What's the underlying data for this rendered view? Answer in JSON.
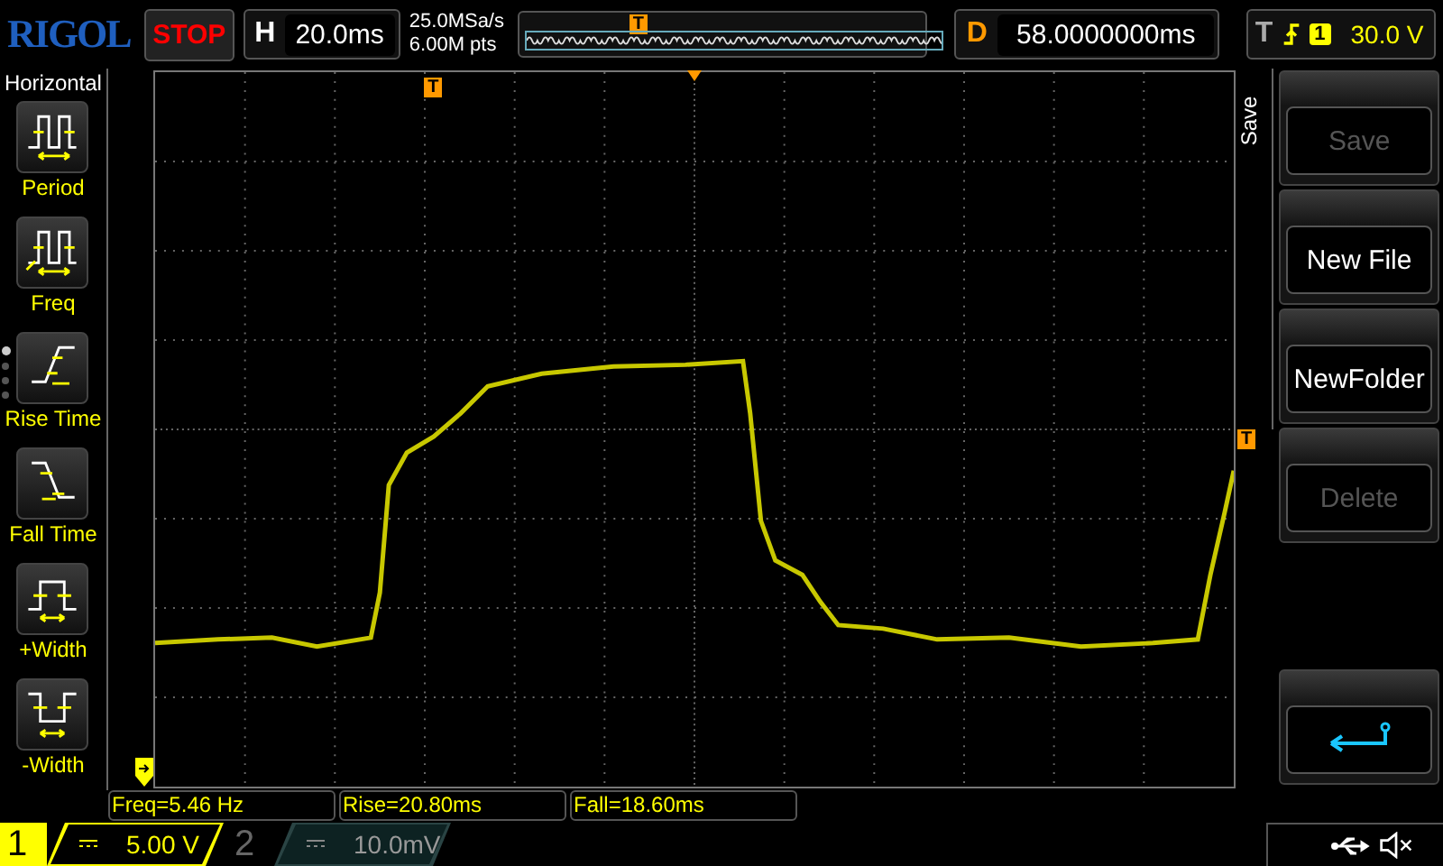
{
  "brand": "RIGOL",
  "run_state": "STOP",
  "timebase": {
    "label": "H",
    "value": "20.0ms"
  },
  "acquisition": {
    "sample_rate": "25.0MSa/s",
    "memory_depth": "6.00M pts"
  },
  "overview": {
    "marker": "T"
  },
  "delay": {
    "label": "D",
    "value": "58.0000000ms"
  },
  "trigger": {
    "label": "T",
    "channel": "1",
    "level": "30.0 V"
  },
  "measure_menu": {
    "title": "Horizontal",
    "pages": [
      {
        "selected": true
      },
      {
        "selected": false
      },
      {
        "selected": false
      },
      {
        "selected": false
      }
    ],
    "items": [
      {
        "kind": "period",
        "label": "Period"
      },
      {
        "kind": "freq",
        "label": "Freq"
      },
      {
        "kind": "rise",
        "label": "Rise Time"
      },
      {
        "kind": "fall",
        "label": "Fall Time"
      },
      {
        "kind": "pwidth",
        "label": "+Width"
      },
      {
        "kind": "nwidth",
        "label": "-Width"
      }
    ]
  },
  "graticule": {
    "trigger_position_marker": "T",
    "trigger_level_marker": "T"
  },
  "softkey_menu": {
    "title": "Save",
    "buttons": [
      {
        "kind": "text",
        "label": "Save",
        "disabled": true
      },
      {
        "kind": "text",
        "label": "New File",
        "disabled": false
      },
      {
        "kind": "text",
        "label": "NewFolder",
        "disabled": false
      },
      {
        "kind": "text",
        "label": "Delete",
        "disabled": true
      },
      {
        "kind": "back"
      }
    ]
  },
  "measurements": [
    "Freq=5.46 Hz",
    "Rise=20.80ms",
    "Fall=18.60ms"
  ],
  "channels": [
    {
      "number": "1",
      "scale": "5.00 V",
      "on": true
    },
    {
      "number": "2",
      "scale": "10.0mV",
      "on": false
    }
  ]
}
